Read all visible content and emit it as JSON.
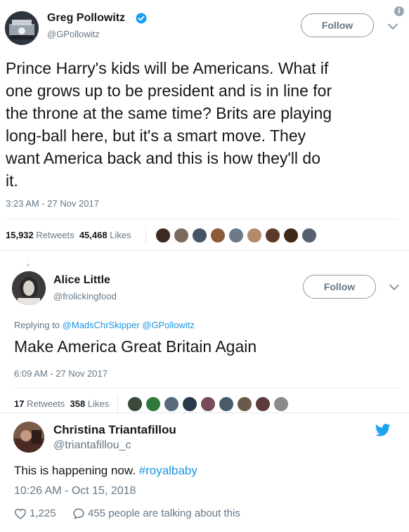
{
  "tweet1": {
    "name": "Greg Pollowitz",
    "handle": "@GPollowitz",
    "follow_label": "Follow",
    "lines": [
      "Prince Harry's kids will be Americans. What if",
      "one grows up to be president and is in line for",
      "the throne at the same time? Brits are playing",
      "long-ball here, but it's a smart move. They",
      "want America back and this is how they'll do",
      "it."
    ],
    "timestamp": "3:23 AM - 27 Nov 2017",
    "retweets_count": "15,932",
    "retweets_label": "Retweets",
    "likes_count": "45,468",
    "likes_label": "Likes",
    "liker_colors": [
      "#3b2a20",
      "#7a6b5c",
      "#445566",
      "#8a5a3a",
      "#6c7a88",
      "#b58a6a",
      "#5a3a2a",
      "#402818",
      "#556070"
    ]
  },
  "reply": {
    "name": "Alice Little",
    "handle": "@frolickingfood",
    "follow_label": "Follow",
    "replying_prefix": "Replying to",
    "replying_users": "@MadsChrSkipper @GPollowitz",
    "text": "Make America Great Britain Again",
    "timestamp": "6:09 AM - 27 Nov 2017",
    "retweets_count": "17",
    "retweets_label": "Retweets",
    "likes_count": "358",
    "likes_label": "Likes",
    "liker_colors": [
      "#3a4a3a",
      "#2f7a3a",
      "#5a6a7a",
      "#2a3a4a",
      "#7a4a5a",
      "#4a5a6a",
      "#6a5a4a",
      "#5a3a3a",
      "#8a8a8a"
    ]
  },
  "embed": {
    "name": "Christina Triantafillou",
    "handle": "@triantafillou_c",
    "text_plain": "This is happening now.",
    "hashtag": "#royalbaby",
    "timestamp": "10:26 AM - Oct 15, 2018",
    "likes_count": "1,225",
    "talking_text": "455 people are talking about this"
  },
  "colors": {
    "verified": "#1da1f2",
    "link": "#1b95e0",
    "twitter_bird": "#1da1f2",
    "muted": "#657786"
  }
}
